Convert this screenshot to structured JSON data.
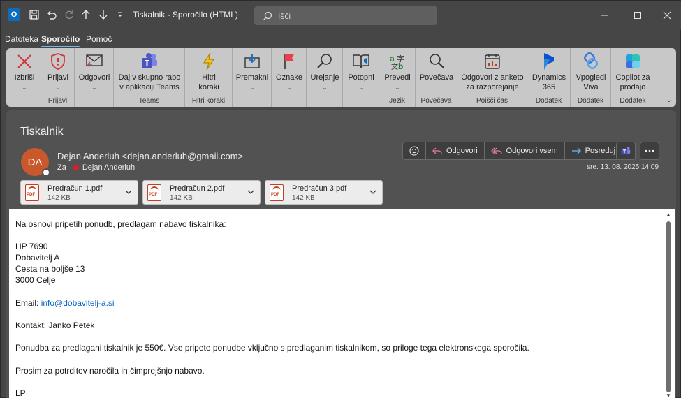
{
  "window": {
    "title": "Tiskalnik  -  Sporočilo (HTML)",
    "search_placeholder": "Išči"
  },
  "menu": {
    "tabs": [
      "Datoteka",
      "Sporočilo",
      "Pomoč"
    ],
    "active": "Sporočilo"
  },
  "ribbon": {
    "delete": "Izbriši",
    "report": "Prijavi",
    "report_group": "Prijavi",
    "reply": "Odgovori",
    "teams_share_1": "Daj v skupno rabo",
    "teams_share_2": "v aplikaciji Teams",
    "teams_group": "Teams",
    "quick_steps_1": "Hitri",
    "quick_steps_2": "koraki",
    "quick_steps_group": "Hitri koraki",
    "move": "Premakni",
    "tags": "Oznake",
    "editing": "Urejanje",
    "speech": "Potopni",
    "translate": "Prevedi",
    "language_group": "Jezik",
    "zoom": "Povečava",
    "zoom_group": "Povečava",
    "scheduling_1": "Odgovori z anketo",
    "scheduling_2": "za razporejanje",
    "find_time_group": "Poišči čas",
    "dynamics_1": "Dynamics",
    "dynamics_2": "365",
    "addin_group": "Dodatek",
    "viva_1": "Vpogledi",
    "viva_2": "Viva",
    "copilot_1": "Copilot za",
    "copilot_2": "prodajo"
  },
  "message": {
    "subject": "Tiskalnik",
    "avatar_initials": "DA",
    "sender": "Dejan Anderluh <dejan.anderluh@gmail.com>",
    "to_label": "Za",
    "to_name": "Dejan Anderluh",
    "datetime": "sre. 13. 08. 2025 14:09",
    "actions": {
      "reply": "Odgovori",
      "reply_all": "Odgovori vsem",
      "forward": "Posreduj"
    },
    "attachments": [
      {
        "name": "Predračun 1.pdf",
        "size": "142 KB"
      },
      {
        "name": "Predračun 2.pdf",
        "size": "142 KB"
      },
      {
        "name": "Predračun 3.pdf",
        "size": "142 KB"
      }
    ],
    "body": {
      "intro": "Na osnovi pripetih ponudb, predlagam nabavo tiskalnika:",
      "model": "HP 7690",
      "supplier": "Dobavitelj A",
      "street": "Cesta na boljše 13",
      "city": "3000 Celje",
      "email_label": "Email: ",
      "email": "info@dobavitelj-a.si",
      "contact": "Kontakt: Janko Petek",
      "offer": "Ponudba za predlagani tiskalnik je 550€. Vse pripete ponudbe vključno s predlaganim tiskalnikom, so priloge tega elektronskega sporočila.",
      "request": "Prosim za potrditev naročila in čimprejšnjo nabavo.",
      "signoff": "LP"
    }
  },
  "colors": {
    "accent": "#0f6cbd",
    "ribbon_bg": "#c8c8c8",
    "titlebar_bg": "#464646",
    "avatar_bg": "#c9592d"
  }
}
